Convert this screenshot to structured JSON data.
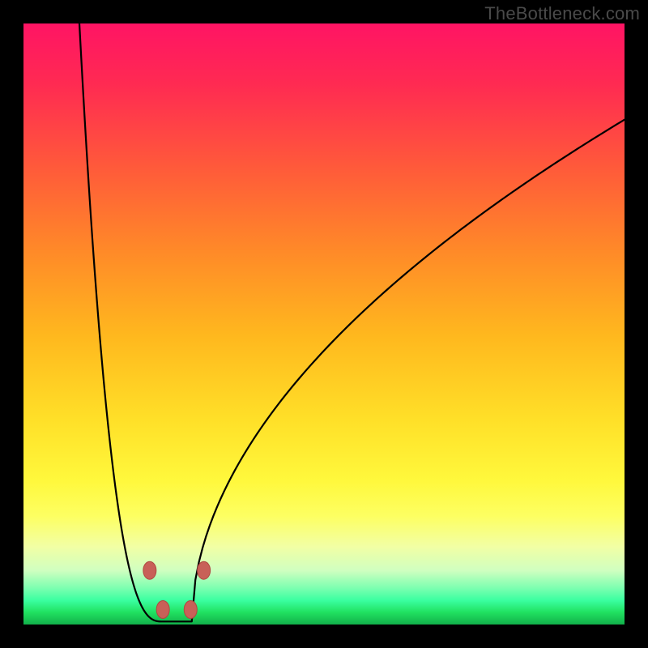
{
  "watermark": "TheBottleneck.com",
  "chart_data": {
    "type": "line",
    "title": "",
    "xlabel": "",
    "ylabel": "",
    "x_range": [
      0,
      1
    ],
    "y_range": [
      0,
      1
    ],
    "curve_min_x": 0.255,
    "curve_min_floor_y": 0.005,
    "left_intercept_x": 0.093,
    "left_intercept_y": 1.0,
    "right_end_x": 1.0,
    "right_end_y": 0.84,
    "left_exponent": 2.6,
    "right_exponent": 0.52,
    "markers": [
      {
        "x": 0.21,
        "y": 0.09
      },
      {
        "x": 0.232,
        "y": 0.025
      },
      {
        "x": 0.278,
        "y": 0.025
      },
      {
        "x": 0.3,
        "y": 0.09
      }
    ],
    "marker_rx": 8,
    "marker_ry": 11,
    "background_gradient_stops": [
      {
        "pos": 0.0,
        "color": "#ff1464"
      },
      {
        "pos": 0.5,
        "color": "#ffb81e"
      },
      {
        "pos": 0.8,
        "color": "#fff83c"
      },
      {
        "pos": 1.0,
        "color": "#12b04a"
      }
    ]
  }
}
